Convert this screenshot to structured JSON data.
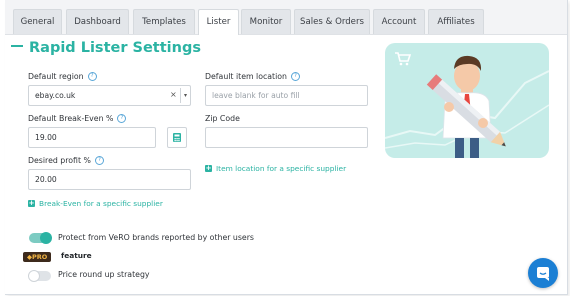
{
  "tabs": [
    {
      "label": "General",
      "active": false
    },
    {
      "label": "Dashboard",
      "active": false
    },
    {
      "label": "Templates",
      "active": false
    },
    {
      "label": "Lister",
      "active": true
    },
    {
      "label": "Monitor",
      "active": false
    },
    {
      "label": "Sales & Orders",
      "active": false
    },
    {
      "label": "Account",
      "active": false
    },
    {
      "label": "Affiliates",
      "active": false
    }
  ],
  "page_title": "Rapid Lister Settings",
  "form": {
    "default_region": {
      "label": "Default region",
      "value": "ebay.co.uk",
      "clear": "×",
      "caret": "▾"
    },
    "default_item_location": {
      "label": "Default item location",
      "placeholder": "leave blank for auto fill"
    },
    "default_break_even": {
      "label": "Default Break-Even %",
      "value": "19.00"
    },
    "zip_code": {
      "label": "Zip Code",
      "value": ""
    },
    "desired_profit": {
      "label": "Desired profit %",
      "value": "20.00"
    },
    "item_location_link": "Item location for a specific supplier",
    "break_even_link": "Break-Even for a specific supplier",
    "help_glyph": "?",
    "plus_glyph": "+"
  },
  "toggles": [
    {
      "label": "Protect from VeRO brands reported by other users",
      "on": true
    },
    {
      "label": "Price round up strategy",
      "on": false
    }
  ],
  "pro_badge": "PRO",
  "pro_feature_text": "feature",
  "colors": {
    "accent": "#2bb3a3",
    "illustration_bg": "#c5ece8",
    "chat_button": "#1b7fd4",
    "help": "#5aa7d8"
  },
  "icons": [
    "calculator-icon",
    "plus-icon",
    "help-icon",
    "diamond-icon",
    "cart-icon",
    "chat-icon"
  ]
}
